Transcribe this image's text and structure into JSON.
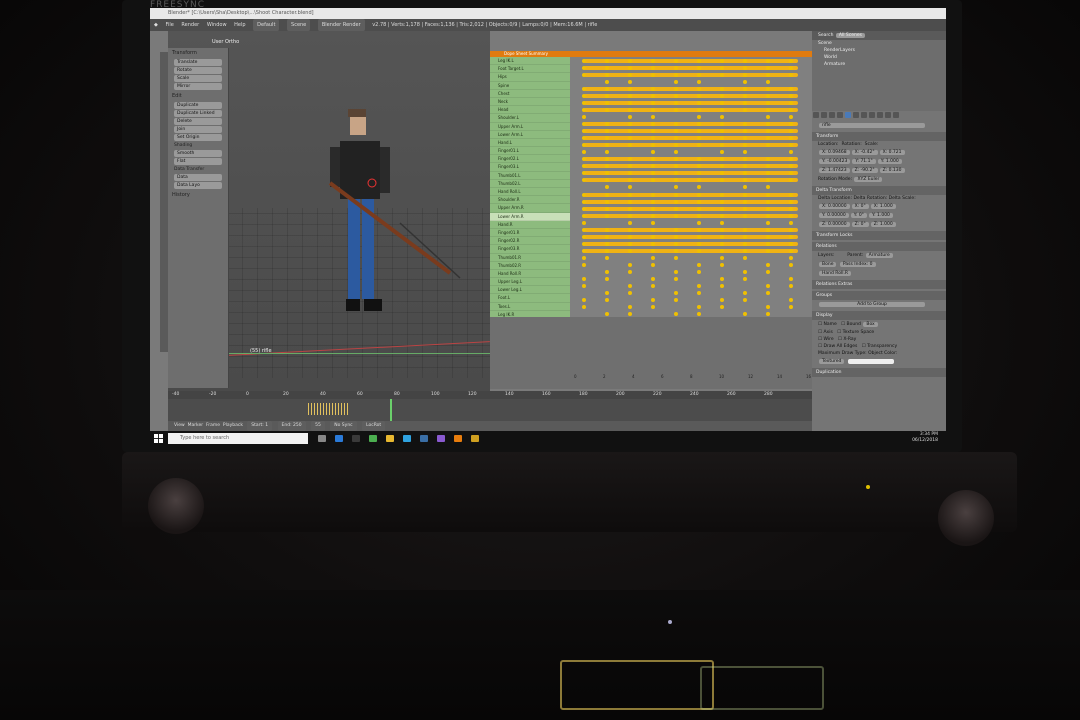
{
  "monitor": {
    "brand": "FREESYNC"
  },
  "window": {
    "title": "Blender* [C:\\Users\\Sha\\Desktop\\...\\Shoot Character.blend]"
  },
  "infobar": {
    "menus": [
      "File",
      "Render",
      "Window",
      "Help"
    ],
    "layout": "Default",
    "scene": "Scene",
    "engine": "Blender Render",
    "stats": "v2.78 | Verts:1,178 | Faces:1,136 | Tris:2,012 | Objects:0/9 | Lamps:0/0 | Mem:16.6M | rifle"
  },
  "viewport": {
    "header_items": [
      "View",
      "Select",
      "Add",
      "Object",
      "Object Mode",
      "Global"
    ],
    "view_label": "User Ortho",
    "object_label": "(55) rifle"
  },
  "toolshelf": {
    "sections": [
      {
        "title": "Transform",
        "buttons": [
          "Translate",
          "Rotate",
          "Scale",
          "Mirror"
        ]
      },
      {
        "title": "Edit",
        "buttons": [
          "Duplicate",
          "Duplicate Linked",
          "Delete",
          "Join",
          "Set Origin"
        ]
      },
      {
        "title": "Shading",
        "buttons": [
          "Smooth",
          "Flat"
        ]
      },
      {
        "title": "Data Transfer",
        "buttons": [
          "Data",
          "Data Layo"
        ]
      }
    ],
    "history": "History"
  },
  "dopesheet": {
    "summary_label": "Dope Sheet Summary",
    "channels": [
      "Leg IK.L",
      "Foot Target.L",
      "Hips",
      "Spine",
      "Chest",
      "Neck",
      "Head",
      "Shoulder.L",
      "Upper Arm.L",
      "Lower Arm.L",
      "Hand.L",
      "Finger01.L",
      "Finger02.L",
      "Finger03.L",
      "Thumb01.L",
      "Thumb02.L",
      "Hand Roll.L",
      "Shoulder.R",
      "Upper Arm.R",
      "Lower Arm.R",
      "Hand.R",
      "Finger01.R",
      "Finger02.R",
      "Finger03.R",
      "Thumb01.R",
      "Thumb02.R",
      "Hand Roll.R",
      "Upper Leg.L",
      "Lower Leg.L",
      "Foot.L",
      "Toes.L",
      "Leg IK.R",
      "Foot Target.R",
      "Upper Leg.R",
      "Lower Leg.R",
      "Foot.R",
      "Toes.R"
    ],
    "selected_channel": "Lower Arm.R",
    "ruler": [
      "0",
      "2",
      "4",
      "6",
      "8",
      "10",
      "12",
      "14",
      "16"
    ],
    "header_items": [
      "View",
      "Select",
      "Marker",
      "Channel",
      "Key",
      "Action Editor",
      "rifle"
    ]
  },
  "timeline": {
    "header_items": [
      "View",
      "Marker",
      "Frame",
      "Playback"
    ],
    "ticks": [
      "-40",
      "-20",
      "0",
      "20",
      "40",
      "60",
      "80",
      "100",
      "120",
      "140",
      "160",
      "180",
      "200",
      "220",
      "240",
      "260",
      "280"
    ],
    "start_label": "Start: 1",
    "end_label": "End: 250",
    "current_frame": "55",
    "keying": "No Sync",
    "keyset": "LocRot"
  },
  "outliner": {
    "search_label": "Search",
    "scenes_label": "All Scenes",
    "items": [
      "Scene",
      "RenderLayers",
      "World",
      "Armature"
    ]
  },
  "properties": {
    "object_name": "rifle",
    "transform_header": "Transform",
    "location_label": "Location:",
    "rotation_label": "Rotation:",
    "scale_label": "Scale:",
    "location": [
      "X: 0.09468",
      "Y: -0.00423",
      "Z: 1.47423"
    ],
    "rotation": [
      "X: -0.42°",
      "Y: 71.1°",
      "Z: -90.2°"
    ],
    "scale": [
      "X: 0.721",
      "Y: 1.000",
      "Z: 0.130"
    ],
    "rotation_mode_label": "Rotation Mode:",
    "rotation_mode": "XYZ Euler",
    "delta_header": "Delta Transform",
    "delta_location_label": "Delta Location:",
    "delta_rotation_label": "Delta Rotation:",
    "delta_scale_label": "Delta Scale:",
    "delta_location": [
      "X: 0.00000",
      "Y: 0.00000",
      "Z: 0.00000"
    ],
    "delta_rotation": [
      "X: 0°",
      "Y: 0°",
      "Z: 0°"
    ],
    "delta_scale": [
      "X: 1.000",
      "Y: 1.000",
      "Z: 1.000"
    ],
    "locks_header": "Transform Locks",
    "relations_header": "Relations",
    "layers_label": "Layers:",
    "parent_label": "Parent:",
    "parent_value": "Armature",
    "parent_type": "Bone",
    "pass_index": "Pass Index: 0",
    "bone": "Hand Roll.R",
    "relations_extras": "Relations Extras",
    "groups_header": "Groups",
    "add_group": "Add to Group",
    "display_header": "Display",
    "display_left": [
      "Name",
      "Axis",
      "Wire",
      "Draw All Edges"
    ],
    "display_right": [
      "Bound",
      "Texture Space",
      "X-Ray",
      "Transparency"
    ],
    "bound_type": "Box",
    "max_draw_label": "Maximum Draw Type:",
    "max_draw_value": "Textured",
    "object_color_label": "Object Color:",
    "duplication": "Duplication"
  },
  "taskbar": {
    "search_placeholder": "Type here to search",
    "time": "3:34 PM",
    "date": "06/12/2018",
    "apps": [
      "task-view-icon",
      "edge-icon",
      "store-icon",
      "chrome-icon",
      "explorer-icon",
      "photoshop-icon",
      "steam-icon",
      "vs-icon",
      "blender-icon",
      "app-icon"
    ]
  },
  "colors": {
    "keyframe": "#f0b214",
    "channel_bg": "#8dbb7e",
    "accent": "#e07b10"
  }
}
